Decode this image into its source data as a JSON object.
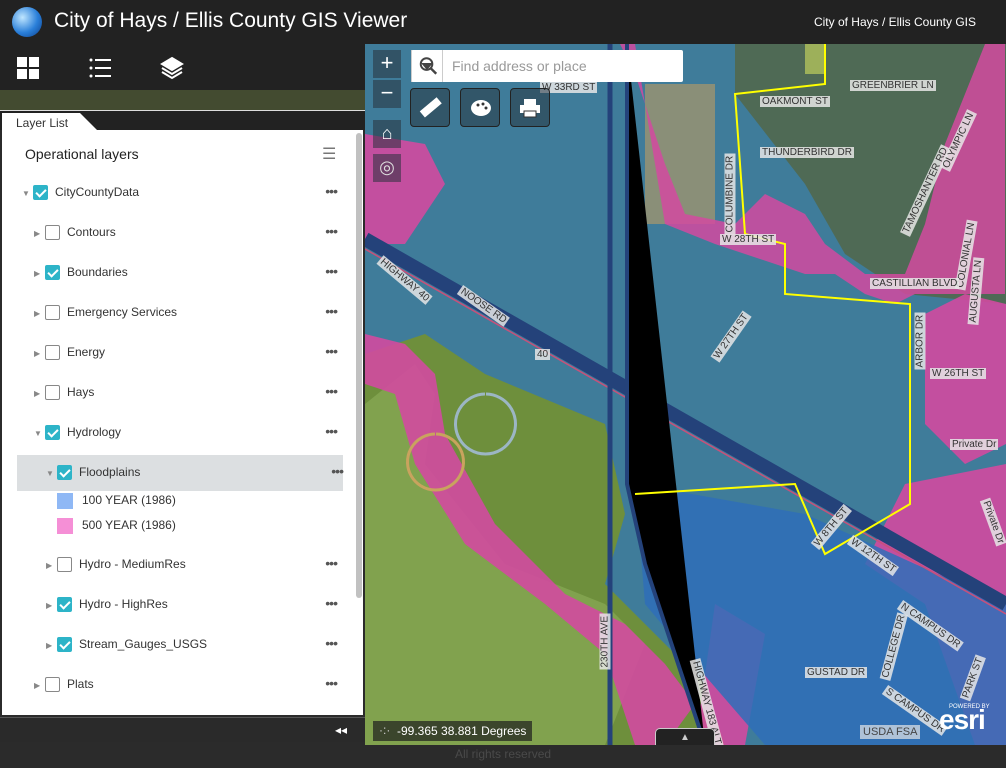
{
  "header": {
    "title": "City of Hays / Ellis County GIS Viewer",
    "subtitle": "City of Hays / Ellis County GIS",
    "logo": "globe-logo"
  },
  "toolbar": {
    "icons": [
      "grid-icon",
      "legend-list-icon",
      "layers-icon"
    ]
  },
  "layer_list": {
    "tab_label": "Layer List",
    "heading": "Operational layers",
    "layers": [
      {
        "label": "CityCountyData",
        "checked": true,
        "expanded": true
      },
      {
        "label": "Contours",
        "checked": false
      },
      {
        "label": "Boundaries",
        "checked": true
      },
      {
        "label": "Emergency Services",
        "checked": false
      },
      {
        "label": "Energy",
        "checked": false
      },
      {
        "label": "Hays",
        "checked": false
      },
      {
        "label": "Hydrology",
        "checked": true,
        "expanded": true
      },
      {
        "label": "Floodplains",
        "checked": true,
        "expanded": true,
        "selected": true
      },
      {
        "label": "Hydro - MediumRes",
        "checked": false
      },
      {
        "label": "Hydro - HighRes",
        "checked": true
      },
      {
        "label": "Stream_Gauges_USGS",
        "checked": true
      },
      {
        "label": "Plats",
        "checked": false
      }
    ],
    "legend": [
      {
        "label": "100 YEAR (1986)",
        "color": "#8fb8f5"
      },
      {
        "label": "500 YEAR (1986)",
        "color": "#f58fd6"
      }
    ],
    "more_label": "•••"
  },
  "map": {
    "search_placeholder": "Find address or place",
    "zoom_in": "+",
    "zoom_out": "−",
    "coordinates": "-99.365 38.881 Degrees",
    "attribution": "USDA FSA",
    "esri_logo": "esri",
    "esri_powered": "POWERED BY",
    "tools": [
      "measure-icon",
      "basemap-palette-icon",
      "print-icon"
    ],
    "labels": [
      "W 33RD ST",
      "OAKMONT ST",
      "GREENBRIER LN",
      "THUNDERBIRD DR",
      "COLUMBINE DR",
      "TAMOSHANTER RD",
      "OLYMPIC LN",
      "W 28TH ST",
      "COLONIAL LN",
      "CASTILLIAN BLVD",
      "AUGUSTA LN",
      "HIGHWAY 40",
      "NOOSE RD",
      "40",
      "W 27TH ST",
      "ARBOR DR",
      "W 26TH ST",
      "Private Dr",
      "W 8TH ST",
      "W 12TH ST",
      "N CAMPUS DR",
      "COLLEGE DR",
      "GUSTAD DR",
      "S CAMPUS DR",
      "PARK ST",
      "230TH AVE",
      "HIGHWAY 183 ALT",
      "Private Dr"
    ]
  },
  "footer": {
    "text": "All rights reserved",
    "collapse": "◂◂"
  }
}
